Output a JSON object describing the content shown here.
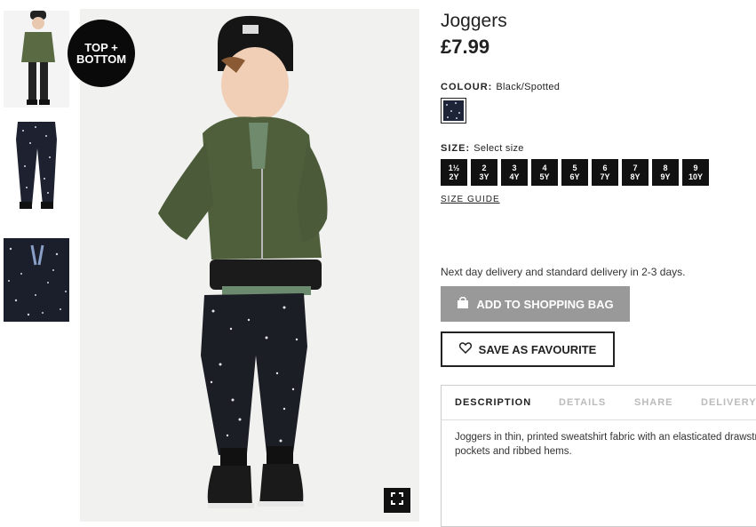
{
  "badge": {
    "text": "TOP +\nBOTTOM"
  },
  "product": {
    "title": "Joggers",
    "price": "£7.99",
    "colour_label": "COLOUR:",
    "colour_value": "Black/Spotted",
    "size_label": "SIZE:",
    "size_value": "Select size",
    "sizes": [
      "1½\n2Y",
      "2\n3Y",
      "3\n4Y",
      "4\n5Y",
      "5\n6Y",
      "6\n7Y",
      "7\n8Y",
      "8\n9Y",
      "9\n10Y"
    ],
    "size_guide": "SIZE GUIDE",
    "delivery_text": "Next day delivery and standard delivery in 2-3 days.",
    "add_to_bag": "ADD TO SHOPPING BAG",
    "save_favourite": "SAVE AS FAVOURITE"
  },
  "tabs": {
    "description": "DESCRIPTION",
    "details": "DETAILS",
    "share": "SHARE",
    "delivery": "DELIVERY"
  },
  "description": {
    "line1": "Joggers in thin, printed sweatshirt fabric with an elasticated drawstring waist,",
    "line2": "pockets and ribbed hems."
  },
  "icons": {
    "zoom": "expand-icon",
    "bag": "shopping-bag-icon",
    "heart": "heart-icon"
  },
  "colors": {
    "button_disabled": "#999999",
    "dark": "#111111",
    "swatch": "#1d2438"
  }
}
